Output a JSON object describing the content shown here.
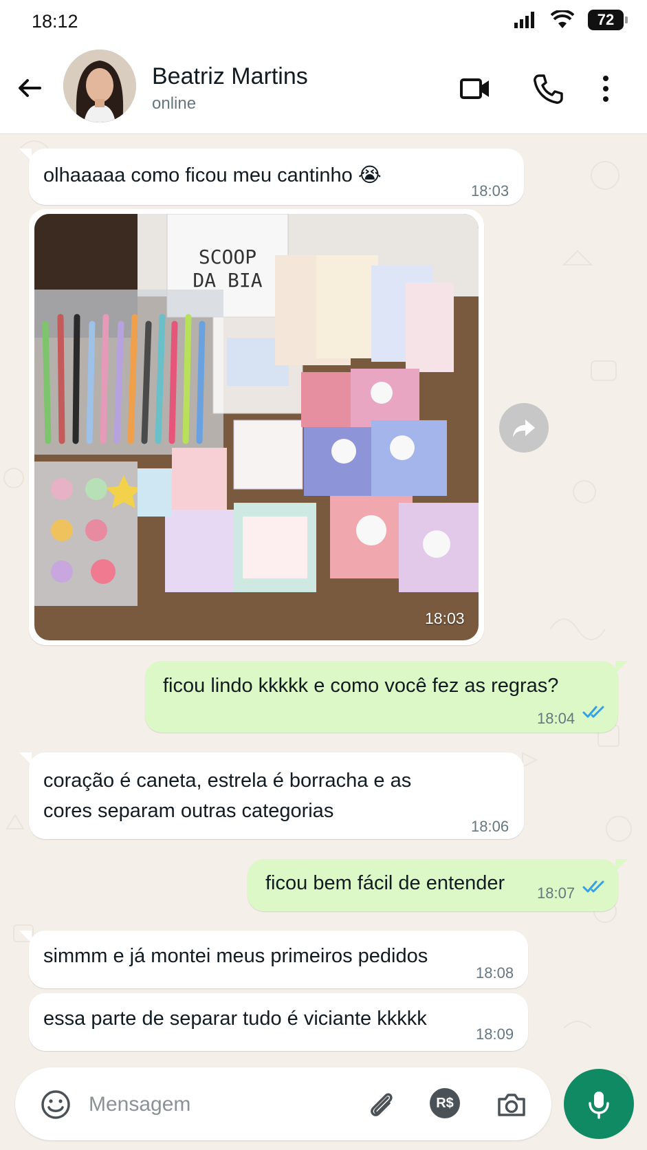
{
  "status_bar": {
    "time": "18:12",
    "battery": "72"
  },
  "contact": {
    "name": "Beatriz Martins",
    "status": "online"
  },
  "messages": [
    {
      "dir": "in",
      "text": "olhaaaaa como ficou meu cantinho 😭",
      "time": "18:03"
    },
    {
      "dir": "in",
      "type": "image",
      "image_text": "SCOOP DA BIA",
      "time": "18:03"
    },
    {
      "dir": "out",
      "text": "ficou lindo kkkkk e como você fez as regras?",
      "time": "18:04"
    },
    {
      "dir": "in",
      "text_line1": "coração é caneta, estrela é borracha e as",
      "text_line2": "cores separam outras categorias",
      "time": "18:06"
    },
    {
      "dir": "out",
      "text": "ficou bem fácil de entender",
      "time": "18:07"
    },
    {
      "dir": "in",
      "text": "simmm e já montei meus primeiros pedidos",
      "time": "18:08"
    },
    {
      "dir": "in",
      "text": "essa parte de separar tudo é viciante kkkkk",
      "time": "18:09"
    }
  ],
  "input": {
    "placeholder": "Mensagem",
    "pix_label": "R$"
  },
  "icons": {
    "back": "arrow-left-icon",
    "video": "video-camera-icon",
    "call": "phone-icon",
    "menu": "more-vertical-icon",
    "emoji": "emoji-icon",
    "attach": "paperclip-icon",
    "camera": "camera-icon",
    "mic": "microphone-icon",
    "forward": "forward-icon",
    "read": "double-check-icon"
  },
  "colors": {
    "accent": "#0f8a63",
    "outgoing": "#dcf8c6",
    "incoming": "#ffffff",
    "read_ticks": "#34a0e6",
    "background": "#f4efe8"
  }
}
